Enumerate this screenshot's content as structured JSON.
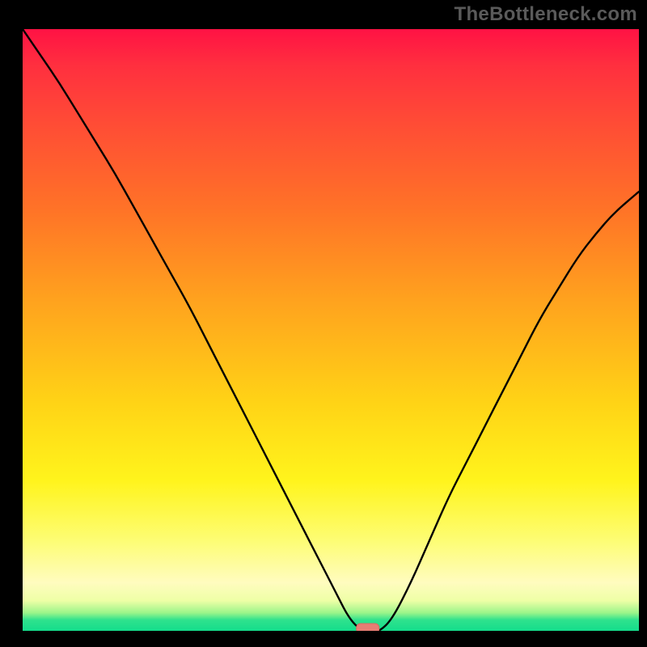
{
  "watermark": "TheBottleneck.com",
  "colors": {
    "curve": "#000000",
    "marker": "#e77d74",
    "frame": "#000000",
    "gradient_top": "#ff1244",
    "gradient_bottom": "#14dd8c"
  },
  "chart_data": {
    "type": "line",
    "title": "",
    "xlabel": "",
    "ylabel": "",
    "xlim": [
      0,
      100
    ],
    "ylim": [
      0,
      100
    ],
    "grid": false,
    "series": [
      {
        "name": "bottleneck-curve",
        "x": [
          0,
          3,
          6,
          9,
          12,
          15,
          18,
          21,
          24,
          27,
          30,
          33,
          36,
          39,
          42,
          45,
          48,
          51,
          53,
          55,
          57,
          58,
          60,
          63,
          66,
          69,
          72,
          75,
          78,
          81,
          84,
          87,
          90,
          93,
          96,
          100
        ],
        "values": [
          100,
          95.5,
          91,
          86,
          81,
          76,
          70.5,
          65,
          59.5,
          54,
          48,
          42,
          36,
          30,
          24,
          18,
          12,
          6,
          2,
          0,
          0,
          0,
          2,
          8,
          15,
          22,
          28,
          34,
          40,
          46,
          52,
          57,
          62,
          66,
          69.5,
          73
        ]
      }
    ],
    "marker": {
      "x": 56,
      "y": 0
    }
  }
}
